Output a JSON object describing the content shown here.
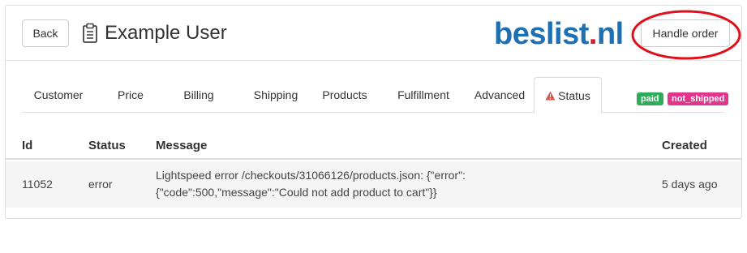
{
  "header": {
    "back_label": "Back",
    "title": "Example User",
    "handle_order_label": "Handle order",
    "logo": {
      "main": "beslist",
      "dot": ".",
      "tld": "nl"
    }
  },
  "tabs": [
    {
      "label": "Customer"
    },
    {
      "label": "Price"
    },
    {
      "label": "Billing"
    },
    {
      "label": "Shipping"
    },
    {
      "label": "Products"
    },
    {
      "label": "Fulfillment"
    },
    {
      "label": "Advanced"
    },
    {
      "label": "Status",
      "active": true,
      "icon": "warning-icon"
    }
  ],
  "badges": {
    "paid": "paid",
    "not_shipped": "not_shipped"
  },
  "table": {
    "columns": [
      "Id",
      "Status",
      "Message",
      "Created"
    ],
    "rows": [
      {
        "id": "11052",
        "status": "error",
        "message_line1": "Lightspeed error /checkouts/31066126/products.json: {\"error\":",
        "message_line2": "{\"code\":500,\"message\":\"Could not add product to cart\"}}",
        "created": "5 days ago"
      }
    ]
  },
  "colors": {
    "logo_blue": "#1f6fb3",
    "logo_red": "#d91a2a",
    "annotation_circle": "#e0101a",
    "badge_paid": "#2eac5a",
    "badge_not_shipped": "#e0368c",
    "warning_icon": "#d9534f"
  }
}
